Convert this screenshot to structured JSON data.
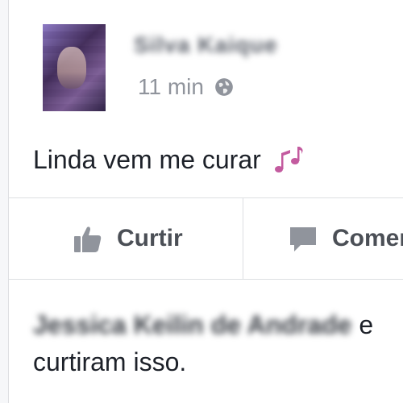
{
  "post": {
    "author_name": "Silva Kaique",
    "time": "11 min",
    "text": "Linda vem me curar"
  },
  "actions": {
    "like_label": "Curtir",
    "comment_label": "Comen"
  },
  "likes": {
    "names": "Jessica Keilin de Andrade",
    "connector": "e",
    "suffix": "curtiram isso."
  },
  "icons": {
    "privacy": "globe-icon",
    "emoji": "music-notes-icon",
    "like": "thumbs-up-icon",
    "comment": "speech-bubble-icon"
  },
  "colors": {
    "music_notes": "#c35b9f",
    "action_gray": "#90949c"
  }
}
